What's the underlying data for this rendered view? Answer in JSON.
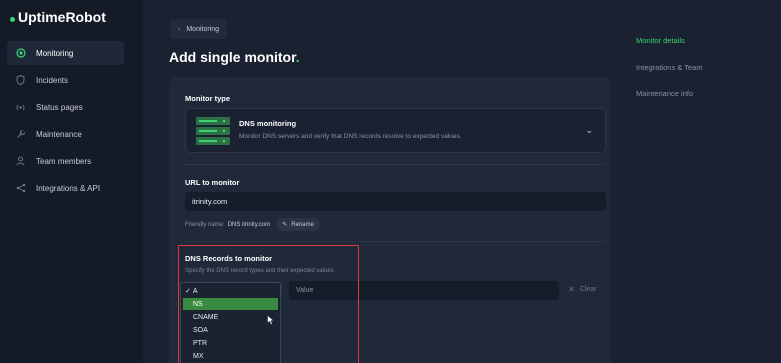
{
  "app": {
    "logo": "UptimeRobot"
  },
  "sidebar": {
    "items": [
      {
        "label": "Monitoring",
        "icon": "monitoring-icon"
      },
      {
        "label": "Incidents",
        "icon": "shield-icon"
      },
      {
        "label": "Status pages",
        "icon": "broadcast-icon"
      },
      {
        "label": "Maintenance",
        "icon": "wrench-icon"
      },
      {
        "label": "Team members",
        "icon": "user-icon"
      },
      {
        "label": "Integrations & API",
        "icon": "share-icon"
      }
    ]
  },
  "header": {
    "back_label": "Monitoring",
    "title": "Add single monitor",
    "title_dot": "."
  },
  "monitor_type": {
    "label": "Monitor type",
    "selected_title": "DNS monitoring",
    "selected_desc": "Monitor DNS servers and verify that DNS records resolve to expected values."
  },
  "url": {
    "label": "URL to monitor",
    "value": "itrinity.com",
    "friendly_prefix": "Friendly name:",
    "friendly_value": "DNS itrinity.com",
    "rename_label": "Rename"
  },
  "dns": {
    "label": "DNS Records to monitor",
    "sublabel": "Specify the DNS record types and their expected values",
    "value_placeholder": "Value",
    "clear_label": "Clear",
    "options": [
      "A",
      "NS",
      "CNAME",
      "SOA",
      "PTR",
      "MX"
    ],
    "selected": "A",
    "hovered": "NS"
  },
  "right_nav": {
    "items": [
      "Monitor details",
      "Integrations & Team",
      "Maintenance info"
    ]
  },
  "colors": {
    "accent": "#3bd671",
    "highlight_border": "#e0383e",
    "hover_option": "#3a8a3f"
  }
}
